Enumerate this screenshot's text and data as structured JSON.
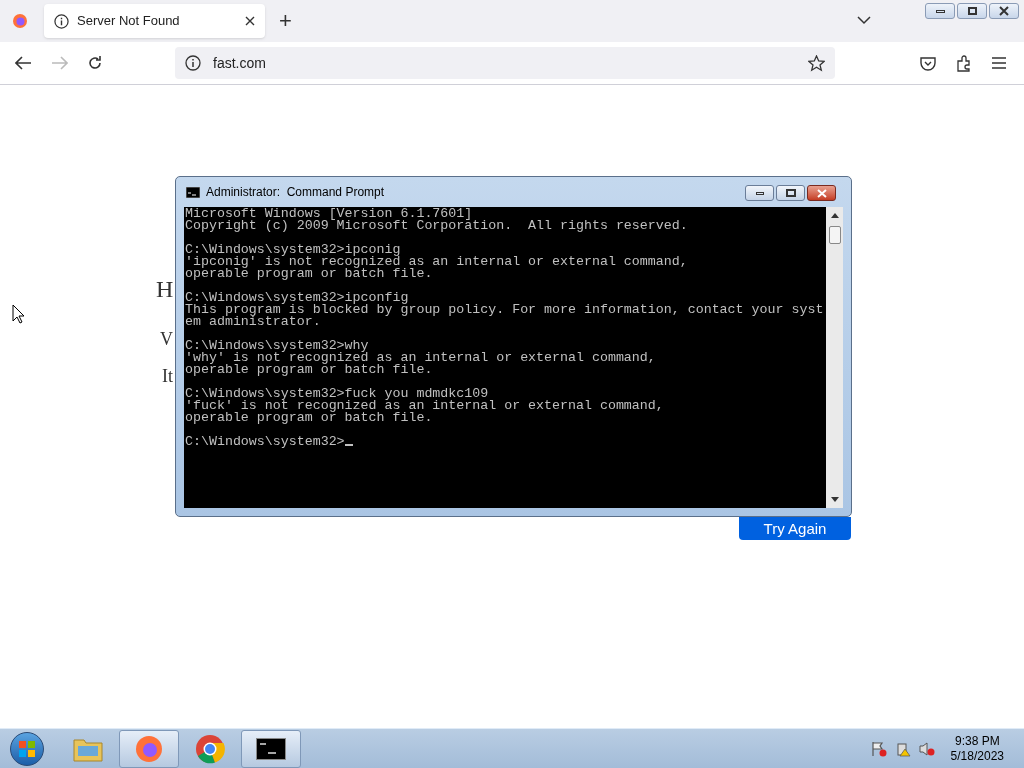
{
  "browser": {
    "tabs": [
      {
        "label": "Server Not Found",
        "selected": true
      }
    ],
    "address": "fast.com",
    "new_tab": "+"
  },
  "page": {
    "peek_texts": [
      "H",
      "V",
      "It"
    ],
    "button": "Try Again"
  },
  "console": {
    "title": "Administrator:  Command Prompt",
    "blocks": [
      [
        "Microsoft Windows [Version 6.1.7601]",
        "Copyright (c) 2009 Microsoft Corporation.  All rights reserved."
      ],
      [
        "C:\\Windows\\system32>ipconig",
        "'ipconig' is not recognized as an internal or external command,",
        "operable program or batch file."
      ],
      [
        "C:\\Windows\\system32>ipconfig",
        "This program is blocked by group policy. For more information, contact your syst",
        "em administrator."
      ],
      [
        "C:\\Windows\\system32>why",
        "'why' is not recognized as an internal or external command,",
        "operable program or batch file."
      ],
      [
        "C:\\Windows\\system32>fuck you mdmdkc109",
        "'fuck' is not recognized as an internal or external command,",
        "operable program or batch file."
      ],
      [
        "C:\\Windows\\system32>"
      ]
    ],
    "cursor": true
  },
  "taskbar": {
    "apps": [
      {
        "kind": "folder",
        "selected": false
      },
      {
        "kind": "firefox",
        "selected": true
      },
      {
        "kind": "chrome",
        "selected": false
      },
      {
        "kind": "cmd",
        "selected": true
      }
    ],
    "time": "9:38 PM",
    "date": "5/18/2023"
  }
}
